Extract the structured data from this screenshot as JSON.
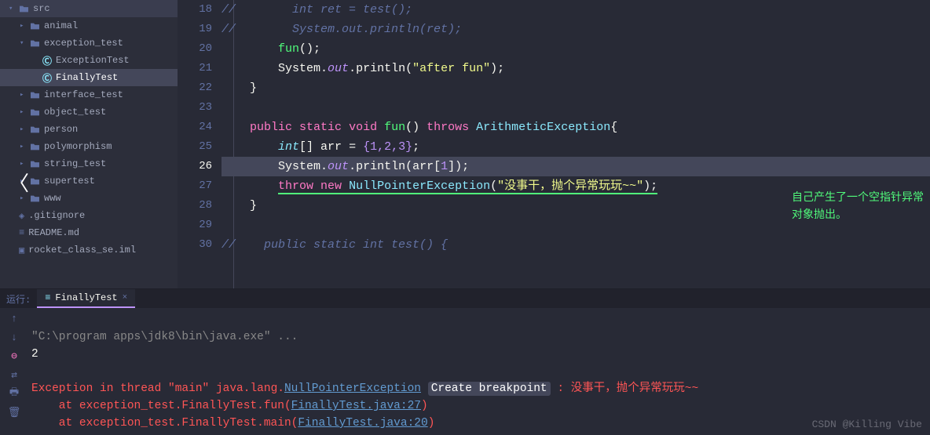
{
  "sidebar": {
    "items": [
      {
        "label": "src",
        "type": "folder",
        "indent": 0,
        "chevron": "v"
      },
      {
        "label": "animal",
        "type": "folder",
        "indent": 1,
        "chevron": ">"
      },
      {
        "label": "exception_test",
        "type": "folder",
        "indent": 1,
        "chevron": "v"
      },
      {
        "label": "ExceptionTest",
        "type": "class",
        "indent": 2,
        "chevron": ""
      },
      {
        "label": "FinallyTest",
        "type": "class",
        "indent": 2,
        "chevron": "",
        "selected": true
      },
      {
        "label": "interface_test",
        "type": "folder",
        "indent": 1,
        "chevron": ">"
      },
      {
        "label": "object_test",
        "type": "folder",
        "indent": 1,
        "chevron": ">"
      },
      {
        "label": "person",
        "type": "folder",
        "indent": 1,
        "chevron": ">"
      },
      {
        "label": "polymorphism",
        "type": "folder",
        "indent": 1,
        "chevron": ">"
      },
      {
        "label": "string_test",
        "type": "folder",
        "indent": 1,
        "chevron": ">"
      },
      {
        "label": "supertest",
        "type": "folder",
        "indent": 1,
        "chevron": ">"
      },
      {
        "label": "www",
        "type": "folder",
        "indent": 1,
        "chevron": ">"
      },
      {
        "label": ".gitignore",
        "type": "gitignore",
        "indent": 0,
        "chevron": ""
      },
      {
        "label": "README.md",
        "type": "md",
        "indent": 0,
        "chevron": ""
      },
      {
        "label": "rocket_class_se.iml",
        "type": "iml",
        "indent": 0,
        "chevron": ""
      }
    ]
  },
  "editor": {
    "lines": [
      "18",
      "19",
      "20",
      "21",
      "22",
      "23",
      "24",
      "25",
      "26",
      "27",
      "28",
      "29",
      "30"
    ],
    "activeLine": "26",
    "code": {
      "l18": {
        "comment": "//        int ret = test();"
      },
      "l19": {
        "comment": "//        System.out.println(ret);"
      },
      "l20": {
        "fn": "fun",
        "after": "();"
      },
      "l21": {
        "sys": "System",
        "out": "out",
        "meth": "println",
        "str": "\"after fun\""
      },
      "l22": {
        "brace": "}"
      },
      "l24": {
        "kw1": "public",
        "kw2": "static",
        "kw3": "void",
        "fn": "fun",
        "kw4": "throws",
        "cls": "ArithmeticException"
      },
      "l25": {
        "type": "int",
        "arr": "arr",
        "nums": "{1,2,3}"
      },
      "l26": {
        "sys": "System",
        "out": "out",
        "meth": "println",
        "arr": "arr",
        "idx": "1"
      },
      "l27": {
        "kw1": "throw",
        "kw2": "new",
        "cls": "NullPointerException",
        "str": "\"没事干，抛个异常玩玩~~\""
      },
      "l28": {
        "brace": "}"
      },
      "l30": {
        "comment": "//    public static int test() {"
      }
    },
    "annotation": "自己产生了一个空指针异常对象抛出。"
  },
  "runTab": {
    "label": "运行:",
    "title": "FinallyTest",
    "close": "×"
  },
  "console": {
    "cmd": "\"C:\\program apps\\jdk8\\bin\\java.exe\" ...",
    "out1": "2",
    "errHead": "Exception in thread \"main\" ",
    "errClass": "java.lang.",
    "errLink1": "NullPointerException",
    "bpBtn": "Create breakpoint",
    "errMsg": " : 没事干，抛个异常玩玩~~",
    "trace1a": "    at exception_test.FinallyTest.fun(",
    "trace1b": "FinallyTest.java:27",
    "trace2a": "    at exception_test.FinallyTest.main(",
    "trace2b": "FinallyTest.java:20"
  },
  "watermark": "CSDN @Killing Vibe"
}
